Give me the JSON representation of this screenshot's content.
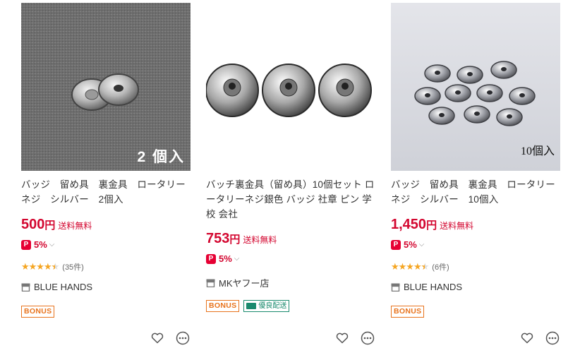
{
  "products": [
    {
      "image_overlay": "2 個入",
      "title": "バッジ　留め具　裏金具　ロータリーネジ　シルバー　2個入",
      "price": "500",
      "yen": "円",
      "shipping": "送料無料",
      "pay": "5%",
      "rating": 4.5,
      "reviews": "(35件)",
      "store": "BLUE HANDS",
      "badges": [
        "BONUS"
      ]
    },
    {
      "image_overlay": "",
      "title": "バッチ裏金具（留め具）10個セット ロータリーネジ銀色 バッジ 社章 ピン 学校 会社",
      "price": "753",
      "yen": "円",
      "shipping": "送料無料",
      "pay": "5%",
      "rating": null,
      "reviews": "",
      "store": "MKヤフー店",
      "badges": [
        "BONUS",
        "優良配送"
      ]
    },
    {
      "image_overlay": "10個入",
      "title": "バッジ　留め具　裏金具　ロータリーネジ　シルバー　10個入",
      "price": "1,450",
      "yen": "円",
      "shipping": "送料無料",
      "pay": "5%",
      "rating": 4.5,
      "reviews": "(6件)",
      "store": "BLUE HANDS",
      "badges": [
        "BONUS"
      ]
    }
  ],
  "icons": {
    "favorite": "heart-icon",
    "more": "more-icon",
    "store": "store-icon",
    "pay": "paypay-icon"
  },
  "colors": {
    "price": "#d3062f",
    "star": "#f5a623",
    "bonus": "#e8731c",
    "fast_delivery": "#1a8a6e"
  }
}
